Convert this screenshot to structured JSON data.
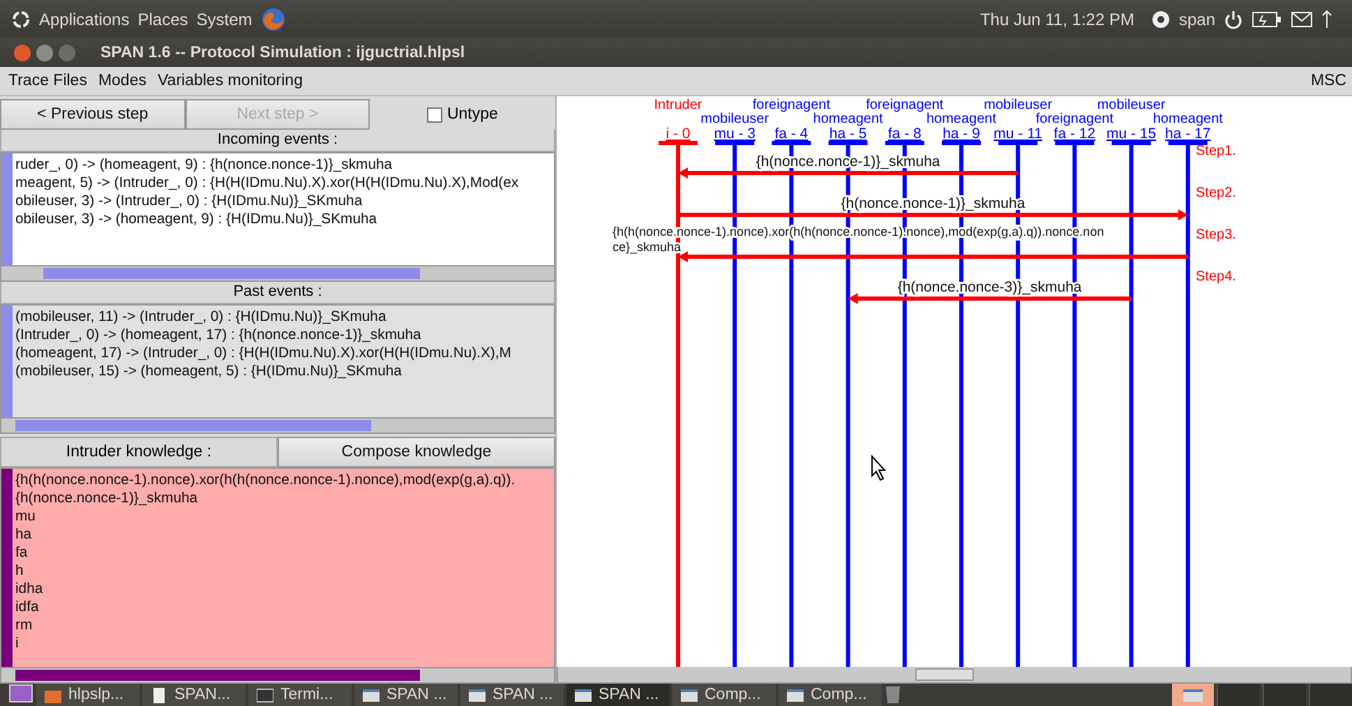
{
  "top_panel": {
    "menus": [
      "Applications",
      "Places",
      "System"
    ],
    "clock": "Thu Jun 11,  1:22 PM",
    "user": "span"
  },
  "window": {
    "title": "SPAN 1.6 -- Protocol Simulation : ijguctrial.hlpsl"
  },
  "menu_bar": {
    "items": [
      "Trace Files",
      "Modes",
      "Variables monitoring"
    ],
    "right_label": "MSC"
  },
  "controls": {
    "previous": {
      "label": "< Previous step",
      "disabled": false
    },
    "next": {
      "label": "Next step >",
      "disabled": true
    },
    "untype": {
      "label": "Untype",
      "checked": false
    }
  },
  "incoming": {
    "title": "Incoming events :",
    "lines": [
      "ruder_, 0) -> (homeagent, 9) : {h(nonce.nonce-1)}_skmuha",
      "meagent, 5) -> (Intruder_, 0) : {H(H(IDmu.Nu).X).xor(H(H(IDmu.Nu).X),Mod(ex",
      "obileuser, 3) -> (Intruder_, 0) : {H(IDmu.Nu)}_SKmuha",
      "obileuser, 3) -> (homeagent, 9) : {H(IDmu.Nu)}_SKmuha"
    ]
  },
  "past": {
    "title": "Past events :",
    "lines": [
      "(mobileuser, 11) -> (Intruder_, 0) : {H(IDmu.Nu)}_SKmuha",
      "(Intruder_, 0) -> (homeagent, 17) : {h(nonce.nonce-1)}_skmuha",
      "(homeagent, 17) -> (Intruder_, 0) : {H(H(IDmu.Nu).X).xor(H(H(IDmu.Nu).X),M",
      "(mobileuser, 15) -> (homeagent, 5) : {H(IDmu.Nu)}_SKmuha"
    ]
  },
  "knowledge": {
    "title": "Intruder knowledge :",
    "compose_button": "Compose knowledge",
    "lines": [
      "{h(h(nonce.nonce-1).nonce).xor(h(h(nonce.nonce-1).nonce),mod(exp(g,a).q)).",
      "{h(nonce.nonce-1)}_skmuha",
      "mu",
      "ha",
      "fa",
      "h",
      "idha",
      "idfa",
      "rm",
      "i"
    ]
  },
  "msc": {
    "lifelines": [
      {
        "name": "Intruder",
        "id": "i - 0",
        "color": "#ff0000"
      },
      {
        "name": "mobileuser",
        "id": "mu - 3",
        "color": "#0000ff"
      },
      {
        "name": "foreignagent",
        "id": "fa - 4",
        "color": "#0000ff"
      },
      {
        "name": "homeagent",
        "id": "ha - 5",
        "color": "#0000ff"
      },
      {
        "name": "foreignagent",
        "id": "fa - 8",
        "color": "#0000ff"
      },
      {
        "name": "homeagent",
        "id": "ha - 9",
        "color": "#0000ff"
      },
      {
        "name": "mobileuser",
        "id": "mu - 11",
        "color": "#0000ff"
      },
      {
        "name": "foreignagent",
        "id": "fa - 12",
        "color": "#0000ff"
      },
      {
        "name": "mobileuser",
        "id": "mu - 15",
        "color": "#0000ff"
      },
      {
        "name": "homeagent",
        "id": "ha - 17",
        "color": "#0000ff"
      }
    ],
    "messages": [
      {
        "step": "Step1.",
        "lines": [
          "{h(nonce.nonce-1)}_skmuha"
        ]
      },
      {
        "step": "Step2.",
        "lines": [
          "{h(nonce.nonce-1)}_skmuha"
        ]
      },
      {
        "step": "Step3.",
        "lines": [
          "{h(h(nonce.nonce-1).nonce).xor(h(h(nonce.nonce-1).nonce),mod(exp(g,a).q)).nonce.non",
          "ce}_skmuha"
        ]
      },
      {
        "step": "Step4.",
        "lines": [
          "{h(nonce.nonce-3)}_skmuha"
        ]
      }
    ]
  },
  "taskbar": [
    {
      "label": "hlpslp...",
      "kind": "folder",
      "selected": false
    },
    {
      "label": "SPAN...",
      "kind": "document",
      "selected": false
    },
    {
      "label": "Termi...",
      "kind": "terminal",
      "selected": false
    },
    {
      "label": "SPAN ...",
      "kind": "window",
      "selected": false
    },
    {
      "label": "SPAN ...",
      "kind": "window",
      "selected": false
    },
    {
      "label": "SPAN ...",
      "kind": "window",
      "selected": true
    },
    {
      "label": "Comp...",
      "kind": "window",
      "selected": false
    },
    {
      "label": "Comp...",
      "kind": "window",
      "selected": false
    }
  ]
}
